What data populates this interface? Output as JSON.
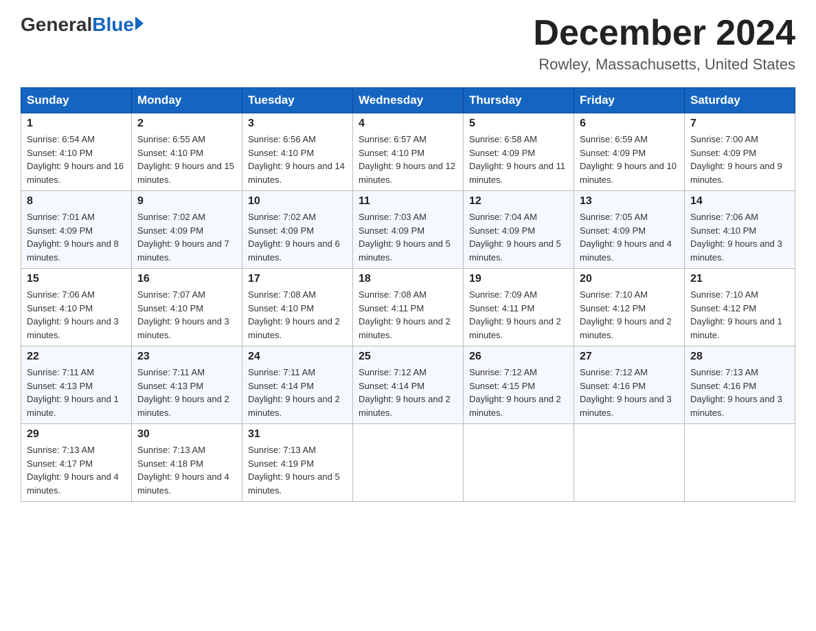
{
  "header": {
    "logo_general": "General",
    "logo_blue": "Blue",
    "title": "December 2024",
    "location": "Rowley, Massachusetts, United States"
  },
  "days_of_week": [
    "Sunday",
    "Monday",
    "Tuesday",
    "Wednesday",
    "Thursday",
    "Friday",
    "Saturday"
  ],
  "weeks": [
    [
      {
        "day": "1",
        "sunrise": "6:54 AM",
        "sunset": "4:10 PM",
        "daylight": "9 hours and 16 minutes."
      },
      {
        "day": "2",
        "sunrise": "6:55 AM",
        "sunset": "4:10 PM",
        "daylight": "9 hours and 15 minutes."
      },
      {
        "day": "3",
        "sunrise": "6:56 AM",
        "sunset": "4:10 PM",
        "daylight": "9 hours and 14 minutes."
      },
      {
        "day": "4",
        "sunrise": "6:57 AM",
        "sunset": "4:10 PM",
        "daylight": "9 hours and 12 minutes."
      },
      {
        "day": "5",
        "sunrise": "6:58 AM",
        "sunset": "4:09 PM",
        "daylight": "9 hours and 11 minutes."
      },
      {
        "day": "6",
        "sunrise": "6:59 AM",
        "sunset": "4:09 PM",
        "daylight": "9 hours and 10 minutes."
      },
      {
        "day": "7",
        "sunrise": "7:00 AM",
        "sunset": "4:09 PM",
        "daylight": "9 hours and 9 minutes."
      }
    ],
    [
      {
        "day": "8",
        "sunrise": "7:01 AM",
        "sunset": "4:09 PM",
        "daylight": "9 hours and 8 minutes."
      },
      {
        "day": "9",
        "sunrise": "7:02 AM",
        "sunset": "4:09 PM",
        "daylight": "9 hours and 7 minutes."
      },
      {
        "day": "10",
        "sunrise": "7:02 AM",
        "sunset": "4:09 PM",
        "daylight": "9 hours and 6 minutes."
      },
      {
        "day": "11",
        "sunrise": "7:03 AM",
        "sunset": "4:09 PM",
        "daylight": "9 hours and 5 minutes."
      },
      {
        "day": "12",
        "sunrise": "7:04 AM",
        "sunset": "4:09 PM",
        "daylight": "9 hours and 5 minutes."
      },
      {
        "day": "13",
        "sunrise": "7:05 AM",
        "sunset": "4:09 PM",
        "daylight": "9 hours and 4 minutes."
      },
      {
        "day": "14",
        "sunrise": "7:06 AM",
        "sunset": "4:10 PM",
        "daylight": "9 hours and 3 minutes."
      }
    ],
    [
      {
        "day": "15",
        "sunrise": "7:06 AM",
        "sunset": "4:10 PM",
        "daylight": "9 hours and 3 minutes."
      },
      {
        "day": "16",
        "sunrise": "7:07 AM",
        "sunset": "4:10 PM",
        "daylight": "9 hours and 3 minutes."
      },
      {
        "day": "17",
        "sunrise": "7:08 AM",
        "sunset": "4:10 PM",
        "daylight": "9 hours and 2 minutes."
      },
      {
        "day": "18",
        "sunrise": "7:08 AM",
        "sunset": "4:11 PM",
        "daylight": "9 hours and 2 minutes."
      },
      {
        "day": "19",
        "sunrise": "7:09 AM",
        "sunset": "4:11 PM",
        "daylight": "9 hours and 2 minutes."
      },
      {
        "day": "20",
        "sunrise": "7:10 AM",
        "sunset": "4:12 PM",
        "daylight": "9 hours and 2 minutes."
      },
      {
        "day": "21",
        "sunrise": "7:10 AM",
        "sunset": "4:12 PM",
        "daylight": "9 hours and 1 minute."
      }
    ],
    [
      {
        "day": "22",
        "sunrise": "7:11 AM",
        "sunset": "4:13 PM",
        "daylight": "9 hours and 1 minute."
      },
      {
        "day": "23",
        "sunrise": "7:11 AM",
        "sunset": "4:13 PM",
        "daylight": "9 hours and 2 minutes."
      },
      {
        "day": "24",
        "sunrise": "7:11 AM",
        "sunset": "4:14 PM",
        "daylight": "9 hours and 2 minutes."
      },
      {
        "day": "25",
        "sunrise": "7:12 AM",
        "sunset": "4:14 PM",
        "daylight": "9 hours and 2 minutes."
      },
      {
        "day": "26",
        "sunrise": "7:12 AM",
        "sunset": "4:15 PM",
        "daylight": "9 hours and 2 minutes."
      },
      {
        "day": "27",
        "sunrise": "7:12 AM",
        "sunset": "4:16 PM",
        "daylight": "9 hours and 3 minutes."
      },
      {
        "day": "28",
        "sunrise": "7:13 AM",
        "sunset": "4:16 PM",
        "daylight": "9 hours and 3 minutes."
      }
    ],
    [
      {
        "day": "29",
        "sunrise": "7:13 AM",
        "sunset": "4:17 PM",
        "daylight": "9 hours and 4 minutes."
      },
      {
        "day": "30",
        "sunrise": "7:13 AM",
        "sunset": "4:18 PM",
        "daylight": "9 hours and 4 minutes."
      },
      {
        "day": "31",
        "sunrise": "7:13 AM",
        "sunset": "4:19 PM",
        "daylight": "9 hours and 5 minutes."
      },
      null,
      null,
      null,
      null
    ]
  ]
}
